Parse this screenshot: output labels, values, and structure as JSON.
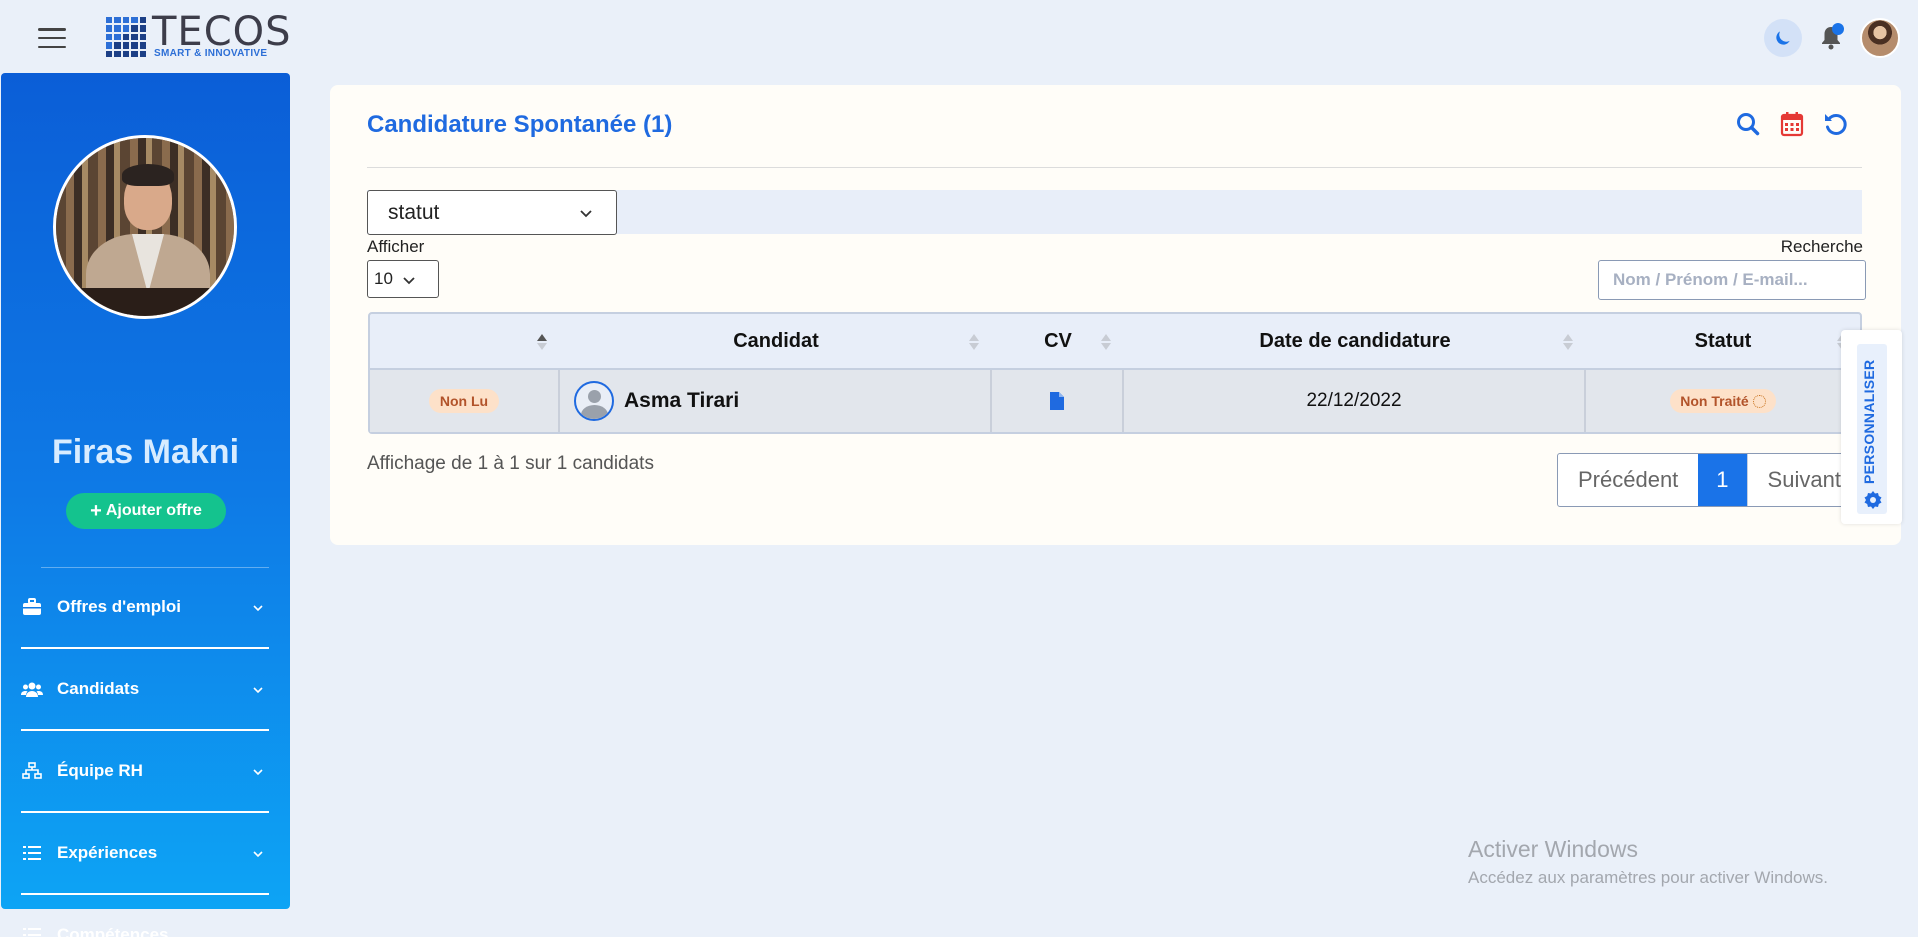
{
  "header": {
    "logo_main": "TECOS",
    "logo_sub": "SMART & INNOVATIVE",
    "icons": [
      "menu-icon",
      "moon-icon",
      "bell-icon",
      "avatar"
    ]
  },
  "sidebar": {
    "profile_name": "Firas Makni",
    "add_offer_label": "Ajouter offre",
    "items": [
      {
        "label": "Offres d'emploi",
        "icon": "briefcase-icon",
        "has_chevron": true
      },
      {
        "label": "Candidats",
        "icon": "users-icon",
        "has_chevron": true
      },
      {
        "label": "Équipe RH",
        "icon": "sitemap-icon",
        "has_chevron": true
      },
      {
        "label": "Expériences",
        "icon": "list-icon",
        "has_chevron": true
      },
      {
        "label": "Compétences",
        "icon": "list-icon",
        "has_chevron": false
      }
    ]
  },
  "main": {
    "title": "Candidature Spontanée (1)",
    "actions": [
      "search-icon",
      "calendar-icon",
      "refresh-icon"
    ],
    "filter": {
      "statut_value": "statut"
    },
    "afficher": {
      "label": "Afficher",
      "value": "10"
    },
    "recherche": {
      "label": "Recherche",
      "placeholder": "Nom / Prénom / E-mail..."
    },
    "table": {
      "headers": [
        "",
        "Candidat",
        "CV",
        "Date de candidature",
        "Statut"
      ],
      "rows": [
        {
          "read_status": "Non Lu",
          "candidat": "Asma Tirari",
          "cv_icon": "file-icon",
          "date": "22/12/2022",
          "statut": "Non Traité"
        }
      ]
    },
    "info_text": "Affichage de 1 à 1 sur 1 candidats",
    "pagination": {
      "prev": "Précédent",
      "current": "1",
      "next": "Suivant"
    }
  },
  "personaliser": {
    "label": "PERSONNALISER"
  },
  "watermark": {
    "line1": "Activer Windows",
    "line2": "Accédez aux paramètres pour activer Windows."
  },
  "colors": {
    "primary": "#1f6ae0",
    "accent_green": "#14c38e",
    "badge_bg": "#fde1c9",
    "badge_text": "#b2532a",
    "calendar_red": "#e53935"
  }
}
